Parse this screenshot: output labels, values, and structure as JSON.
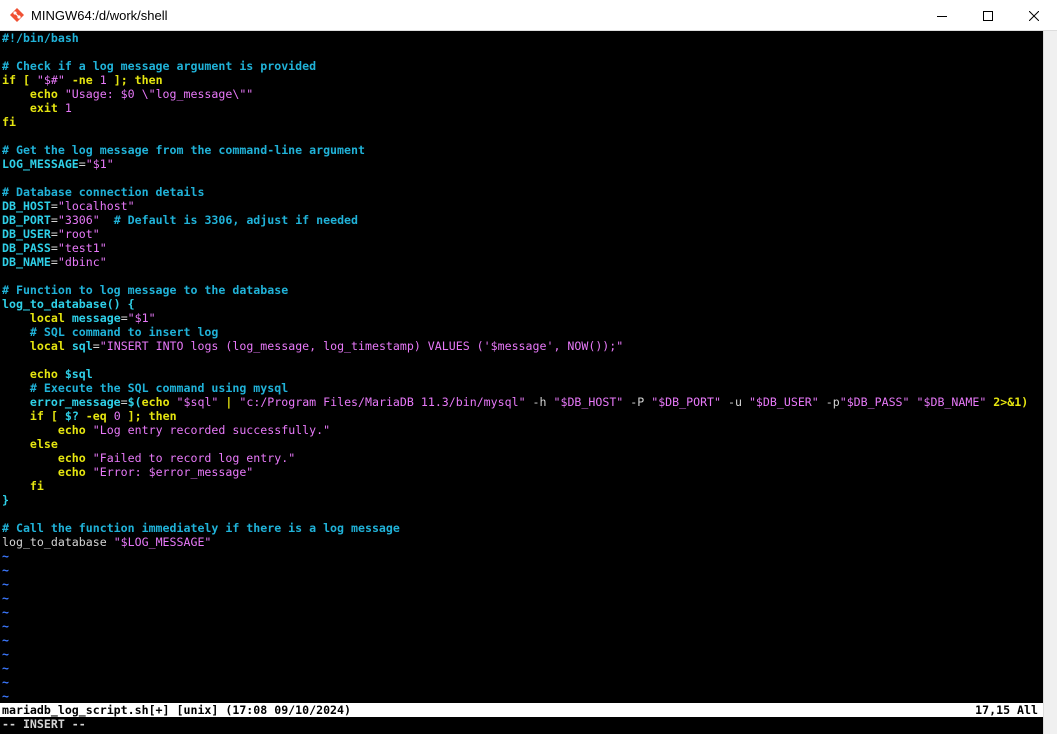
{
  "window": {
    "title": "MINGW64:/d/work/shell",
    "minimize_icon": "minimize-icon",
    "maximize_icon": "maximize-icon",
    "close_icon": "close-icon"
  },
  "colors": {
    "comment": "#20b2d8",
    "keyword": "#e5e510",
    "string": "#e879f9",
    "variable": "#2fd0e8",
    "plain": "#d4d4d4",
    "tilde": "#3b78ff"
  },
  "editor": {
    "lines": [
      [
        {
          "t": "#!/bin/bash",
          "c": "comment"
        }
      ],
      [],
      [
        {
          "t": "# Check if a log message argument is provided",
          "c": "comment"
        }
      ],
      [
        {
          "t": "if",
          "c": "keyword"
        },
        {
          "t": " [ ",
          "c": "keyword"
        },
        {
          "t": "\"$#\"",
          "c": "string"
        },
        {
          "t": " -ne ",
          "c": "keyword"
        },
        {
          "t": "1",
          "c": "string"
        },
        {
          "t": " ]; ",
          "c": "keyword"
        },
        {
          "t": "then",
          "c": "keyword"
        }
      ],
      [
        {
          "t": "    echo ",
          "c": "keyword"
        },
        {
          "t": "\"Usage: $0 \\\"log_message\\\"\"",
          "c": "string"
        }
      ],
      [
        {
          "t": "    exit ",
          "c": "keyword"
        },
        {
          "t": "1",
          "c": "string"
        }
      ],
      [
        {
          "t": "fi",
          "c": "keyword"
        }
      ],
      [],
      [
        {
          "t": "# Get the log message from the command-line argument",
          "c": "comment"
        }
      ],
      [
        {
          "t": "LOG_MESSAGE",
          "c": "var"
        },
        {
          "t": "=",
          "c": "plain"
        },
        {
          "t": "\"$1\"",
          "c": "string"
        }
      ],
      [],
      [
        {
          "t": "# Database connection details",
          "c": "comment"
        }
      ],
      [
        {
          "t": "DB_HOST",
          "c": "var"
        },
        {
          "t": "=",
          "c": "plain"
        },
        {
          "t": "\"localhost\"",
          "c": "string"
        }
      ],
      [
        {
          "t": "DB_PORT",
          "c": "var"
        },
        {
          "t": "=",
          "c": "plain"
        },
        {
          "t": "\"3306\"",
          "c": "string"
        },
        {
          "t": "  # Default is 3306, adjust if needed",
          "c": "comment"
        }
      ],
      [
        {
          "t": "DB_USER",
          "c": "var"
        },
        {
          "t": "=",
          "c": "plain"
        },
        {
          "t": "\"root\"",
          "c": "string"
        }
      ],
      [
        {
          "t": "DB_PASS",
          "c": "var"
        },
        {
          "t": "=",
          "c": "plain"
        },
        {
          "t": "\"test1\"",
          "c": "string"
        }
      ],
      [
        {
          "t": "DB_NAME",
          "c": "var"
        },
        {
          "t": "=",
          "c": "plain"
        },
        {
          "t": "\"dbinc\"",
          "c": "string"
        }
      ],
      [],
      [
        {
          "t": "# Function to log message to the database",
          "c": "comment"
        }
      ],
      [
        {
          "t": "log_to_database() {",
          "c": "var"
        }
      ],
      [
        {
          "t": "    local ",
          "c": "keyword"
        },
        {
          "t": "message",
          "c": "var"
        },
        {
          "t": "=",
          "c": "plain"
        },
        {
          "t": "\"$1\"",
          "c": "string"
        }
      ],
      [
        {
          "t": "    # SQL command to insert log",
          "c": "comment"
        }
      ],
      [
        {
          "t": "    local ",
          "c": "keyword"
        },
        {
          "t": "sql",
          "c": "var"
        },
        {
          "t": "=",
          "c": "plain"
        },
        {
          "t": "\"INSERT INTO logs (log_message, log_timestamp) VALUES ('$message', NOW());\"",
          "c": "string"
        }
      ],
      [],
      [
        {
          "t": "    echo ",
          "c": "keyword"
        },
        {
          "t": "$sql",
          "c": "var"
        }
      ],
      [
        {
          "t": "    # Execute the SQL command using mysql",
          "c": "comment"
        }
      ],
      [
        {
          "t": "    error_message",
          "c": "var"
        },
        {
          "t": "=",
          "c": "plain"
        },
        {
          "t": "$(",
          "c": "var"
        },
        {
          "t": "echo ",
          "c": "keyword"
        },
        {
          "t": "\"$sql\"",
          "c": "string"
        },
        {
          "t": " | ",
          "c": "keyword"
        },
        {
          "t": "\"c:/Program Files/MariaDB 11.3/bin/mysql\"",
          "c": "string"
        },
        {
          "t": " -h ",
          "c": "plain"
        },
        {
          "t": "\"$DB_HOST\"",
          "c": "string"
        },
        {
          "t": " -P ",
          "c": "plain"
        },
        {
          "t": "\"$DB_PORT\"",
          "c": "string"
        },
        {
          "t": " -u ",
          "c": "plain"
        },
        {
          "t": "\"$DB_USER\"",
          "c": "string"
        },
        {
          "t": " -p",
          "c": "plain"
        },
        {
          "t": "\"$DB_PASS\"",
          "c": "string"
        },
        {
          "t": " ",
          "c": "plain"
        },
        {
          "t": "\"$DB_NAME\"",
          "c": "string"
        },
        {
          "t": " 2>&1)",
          "c": "keyword"
        }
      ],
      [
        {
          "t": "    if",
          "c": "keyword"
        },
        {
          "t": " [ ",
          "c": "keyword"
        },
        {
          "t": "$?",
          "c": "var"
        },
        {
          "t": " -eq ",
          "c": "keyword"
        },
        {
          "t": "0",
          "c": "string"
        },
        {
          "t": " ]; ",
          "c": "keyword"
        },
        {
          "t": "then",
          "c": "keyword"
        }
      ],
      [
        {
          "t": "        echo ",
          "c": "keyword"
        },
        {
          "t": "\"Log entry recorded successfully.\"",
          "c": "string"
        }
      ],
      [
        {
          "t": "    else",
          "c": "keyword"
        }
      ],
      [
        {
          "t": "        echo ",
          "c": "keyword"
        },
        {
          "t": "\"Failed to record log entry.\"",
          "c": "string"
        }
      ],
      [
        {
          "t": "        echo ",
          "c": "keyword"
        },
        {
          "t": "\"Error: $error_message\"",
          "c": "string"
        }
      ],
      [
        {
          "t": "    fi",
          "c": "keyword"
        }
      ],
      [
        {
          "t": "}",
          "c": "var"
        }
      ],
      [],
      [
        {
          "t": "# Call the function immediately if there is a log message",
          "c": "comment"
        }
      ],
      [
        {
          "t": "log_to_database ",
          "c": "plain"
        },
        {
          "t": "\"$LOG_MESSAGE\"",
          "c": "string"
        }
      ],
      [
        {
          "t": "~",
          "c": "tilde"
        }
      ],
      [
        {
          "t": "~",
          "c": "tilde"
        }
      ],
      [
        {
          "t": "~",
          "c": "tilde"
        }
      ],
      [
        {
          "t": "~",
          "c": "tilde"
        }
      ],
      [
        {
          "t": "~",
          "c": "tilde"
        }
      ],
      [
        {
          "t": "~",
          "c": "tilde"
        }
      ],
      [
        {
          "t": "~",
          "c": "tilde"
        }
      ],
      [
        {
          "t": "~",
          "c": "tilde"
        }
      ],
      [
        {
          "t": "~",
          "c": "tilde"
        }
      ],
      [
        {
          "t": "~",
          "c": "tilde"
        }
      ],
      [
        {
          "t": "~",
          "c": "tilde"
        }
      ]
    ]
  },
  "status": {
    "left": "mariadb_log_script.sh[+] [unix] (17:08 09/10/2024)",
    "right": "17,15 All"
  },
  "mode": "-- INSERT --"
}
